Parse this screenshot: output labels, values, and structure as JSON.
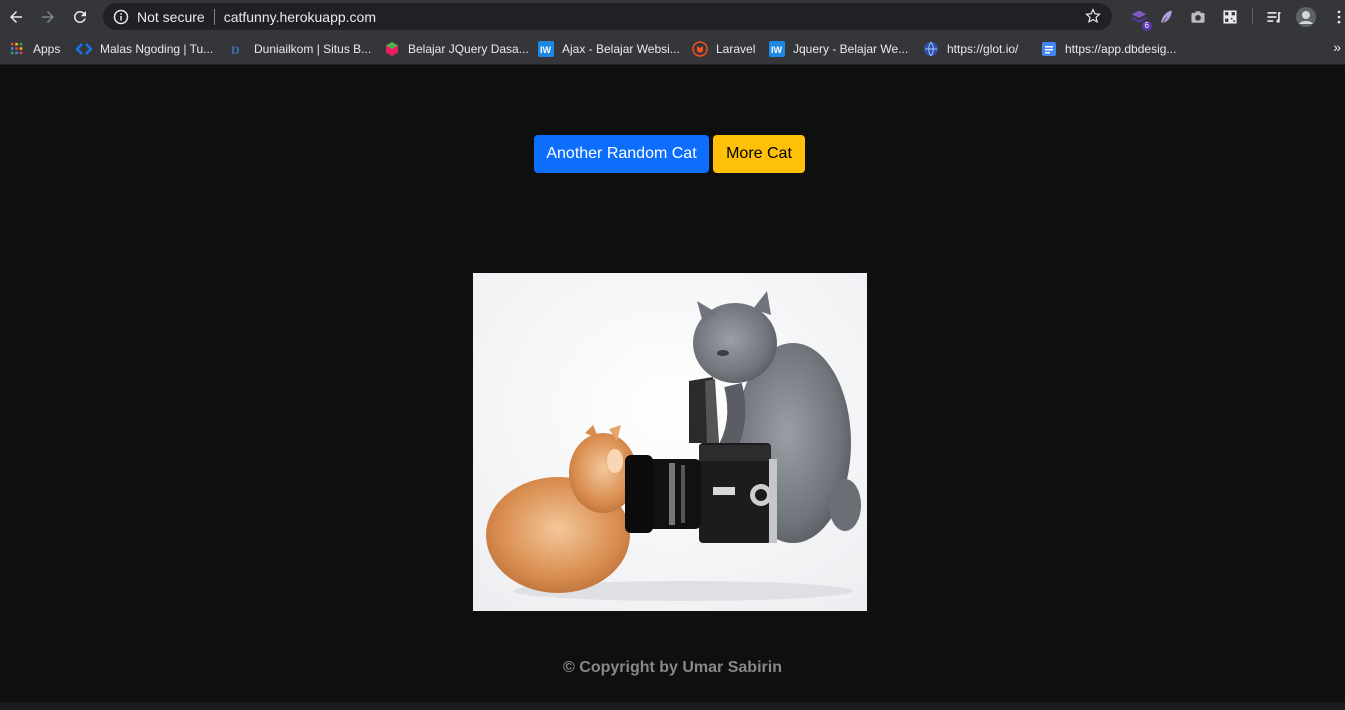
{
  "browser": {
    "security_label": "Not secure",
    "url": "catfunny.herokuapp.com",
    "extension_badge": "6"
  },
  "bookmarks": [
    {
      "label": "Apps",
      "icon": "apps-grid-icon",
      "color": "#ea4335"
    },
    {
      "label": "Malas Ngoding | Tu...",
      "icon": "code-icon",
      "color": "#1a73e8"
    },
    {
      "label": "Duniailkom | Situs B...",
      "icon": "di-logo-icon",
      "color": "#3b5998"
    },
    {
      "label": "Belajar JQuery Dasa...",
      "icon": "cube-icon",
      "color": "#e91e63"
    },
    {
      "label": "Ajax - Belajar Websi...",
      "icon": "iw-logo-icon",
      "color": "#1e88e5"
    },
    {
      "label": "Laravel",
      "icon": "laravel-icon",
      "color": "#f4511e"
    },
    {
      "label": "Jquery - Belajar We...",
      "icon": "iw-logo-icon",
      "color": "#1e88e5"
    },
    {
      "label": "https://glot.io/",
      "icon": "globe-icon",
      "color": "#5c6bc0"
    },
    {
      "label": "https://app.dbdesig...",
      "icon": "document-icon",
      "color": "#4285f4"
    }
  ],
  "bookmarks_more": "»",
  "page": {
    "random_button": "Another Random Cat",
    "more_button": "More Cat",
    "footer": "© Copyright by Umar Sabirin"
  },
  "colors": {
    "primary": "#0d6efd",
    "warning": "#ffc107",
    "background": "#0f0f10"
  }
}
